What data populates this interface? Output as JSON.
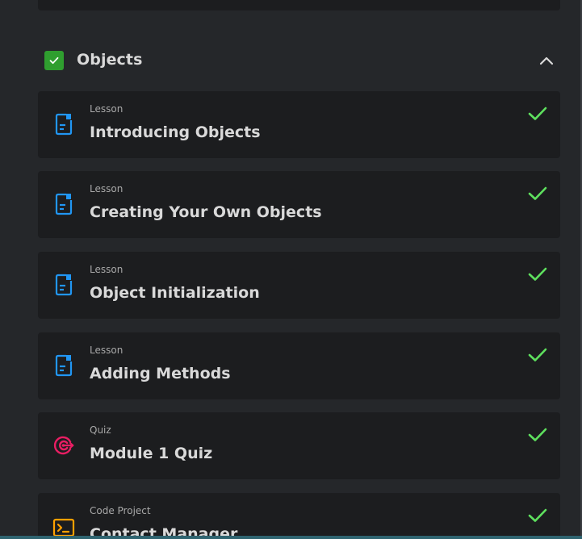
{
  "module": {
    "title": "Objects",
    "completed": true,
    "expanded": true
  },
  "colors": {
    "background": "#25272a",
    "card": "#1c1d1f",
    "complete_green": "#5ee05e",
    "module_check_bg": "#2f9e2f",
    "lesson_icon": "#2196f3",
    "quiz_icon": "#e91e63",
    "project_icon": "#ffa000"
  },
  "items": [
    {
      "kind": "Lesson",
      "title": "Introducing Objects",
      "icon": "lesson-document-icon",
      "completed": true
    },
    {
      "kind": "Lesson",
      "title": "Creating Your Own Objects",
      "icon": "lesson-document-icon",
      "completed": true
    },
    {
      "kind": "Lesson",
      "title": "Object Initialization",
      "icon": "lesson-document-icon",
      "completed": true
    },
    {
      "kind": "Lesson",
      "title": "Adding Methods",
      "icon": "lesson-document-icon",
      "completed": true
    },
    {
      "kind": "Quiz",
      "title": "Module 1 Quiz",
      "icon": "quiz-target-icon",
      "completed": true
    },
    {
      "kind": "Code Project",
      "title": "Contact Manager",
      "icon": "code-terminal-icon",
      "completed": true
    }
  ]
}
